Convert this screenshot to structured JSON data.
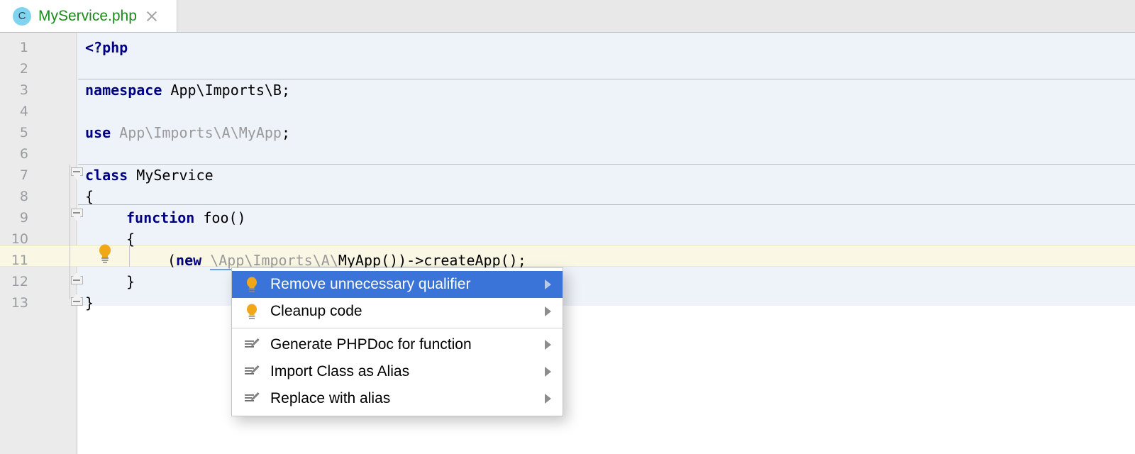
{
  "tab": {
    "icon": "php-class-icon",
    "icon_letter": "C",
    "filename": "MyService.php",
    "close_icon": "close-icon"
  },
  "editor": {
    "lines": [
      {
        "n": "1",
        "indent": 0,
        "segments": [
          {
            "t": "<?php",
            "c": "kw"
          }
        ]
      },
      {
        "n": "2",
        "indent": 0,
        "segments": []
      },
      {
        "n": "3",
        "indent": 0,
        "segments": [
          {
            "t": "namespace",
            "c": "kw"
          },
          {
            "t": " App\\Imports\\B;",
            "c": "plain"
          }
        ]
      },
      {
        "n": "4",
        "indent": 0,
        "segments": []
      },
      {
        "n": "5",
        "indent": 0,
        "segments": [
          {
            "t": "use",
            "c": "kw"
          },
          {
            "t": " App\\Imports\\A\\MyApp",
            "c": "dim"
          },
          {
            "t": ";",
            "c": "plain"
          }
        ]
      },
      {
        "n": "6",
        "indent": 0,
        "segments": []
      },
      {
        "n": "7",
        "indent": 0,
        "segments": [
          {
            "t": "class",
            "c": "kw"
          },
          {
            "t": " MyService",
            "c": "plain"
          }
        ]
      },
      {
        "n": "8",
        "indent": 0,
        "segments": [
          {
            "t": "{",
            "c": "plain"
          }
        ]
      },
      {
        "n": "9",
        "indent": 1,
        "segments": [
          {
            "t": "function",
            "c": "kw"
          },
          {
            "t": " foo()",
            "c": "plain"
          }
        ]
      },
      {
        "n": "10",
        "indent": 1,
        "segments": [
          {
            "t": "{",
            "c": "plain"
          }
        ]
      },
      {
        "n": "11",
        "indent": 2,
        "segments": [
          {
            "t": "(",
            "c": "plain"
          },
          {
            "t": "new",
            "c": "kw"
          },
          {
            "t": " ",
            "c": "plain"
          },
          {
            "t": "\\App\\Imports\\A\\",
            "c": "dim underline-err"
          },
          {
            "t": "MyApp",
            "c": "plain underline-err"
          },
          {
            "t": "())->createApp();",
            "c": "plain"
          }
        ]
      },
      {
        "n": "12",
        "indent": 1,
        "segments": [
          {
            "t": "}",
            "c": "plain"
          }
        ]
      },
      {
        "n": "13",
        "indent": 0,
        "segments": [
          {
            "t": "}",
            "c": "plain"
          }
        ]
      }
    ],
    "current_line_number": "11",
    "gutter_bulb_icon": "intention-lightbulb-icon",
    "fold_markers": [
      {
        "line": "7",
        "dir": "down",
        "icon": "fold-collapse-icon"
      },
      {
        "line": "9",
        "dir": "down",
        "icon": "fold-collapse-icon"
      },
      {
        "line": "12",
        "dir": "up",
        "icon": "fold-end-icon"
      },
      {
        "line": "13",
        "dir": "up",
        "icon": "fold-end-icon"
      }
    ]
  },
  "context_menu": {
    "items": [
      {
        "label": "Remove unnecessary qualifier",
        "icon": "lightbulb-icon",
        "arrow": true,
        "selected": true
      },
      {
        "label": "Cleanup code",
        "icon": "lightbulb-icon",
        "arrow": true,
        "selected": false
      },
      {
        "label": "Generate PHPDoc for function",
        "icon": "edit-pencil-icon",
        "arrow": true,
        "selected": false
      },
      {
        "label": "Import Class as Alias",
        "icon": "edit-pencil-icon",
        "arrow": true,
        "selected": false
      },
      {
        "label": "Replace with alias",
        "icon": "edit-pencil-icon",
        "arrow": true,
        "selected": false
      }
    ],
    "separator_after_index": 1
  },
  "colors": {
    "selection_blue": "#3a74d8",
    "keyword_navy": "#000080",
    "tab_filename_green": "#1a8a1a",
    "bulb_amber": "#f0a818",
    "current_line_yellow": "#faf8e4",
    "editor_bg": "#eef2f9",
    "gutter_bg": "#ebebeb"
  }
}
